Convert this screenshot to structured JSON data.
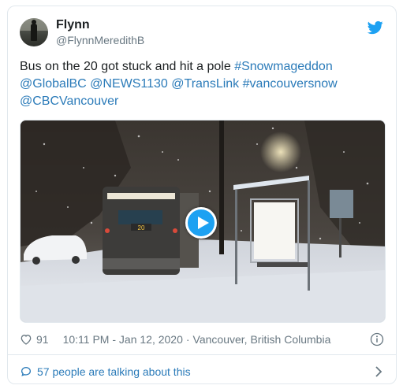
{
  "author": {
    "name": "Flynn",
    "handle": "@FlynnMeredithB"
  },
  "tweet": {
    "text_parts": [
      {
        "text": "Bus on the 20 got stuck and hit a pole ",
        "link": false
      },
      {
        "text": "#Snowmageddon",
        "link": true
      },
      {
        "text": " ",
        "link": false
      },
      {
        "text": "@GlobalBC",
        "link": true
      },
      {
        "text": " ",
        "link": false
      },
      {
        "text": "@NEWS1130",
        "link": true
      },
      {
        "text": " ",
        "link": false
      },
      {
        "text": "@TransLink",
        "link": true
      },
      {
        "text": " ",
        "link": false
      },
      {
        "text": "#vancouversnow",
        "link": true
      },
      {
        "text": " ",
        "link": false
      },
      {
        "text": "@CBCVancouver",
        "link": true
      }
    ]
  },
  "media": {
    "bus_sign": "20"
  },
  "meta": {
    "likes": "91",
    "timestamp": "10:11 PM - Jan 12, 2020",
    "separator": "·",
    "location": "Vancouver, British Columbia"
  },
  "footer": {
    "talking": "57 people are talking about this"
  },
  "colors": {
    "link": "#2b7bb9",
    "twitter_blue": "#1da1f2",
    "muted": "#697882"
  },
  "icons": {
    "brand": "twitter-bird-icon",
    "like": "heart-icon",
    "info": "info-icon",
    "reply": "speech-bubble-icon",
    "more": "chevron-right-icon",
    "video": "play-icon"
  }
}
